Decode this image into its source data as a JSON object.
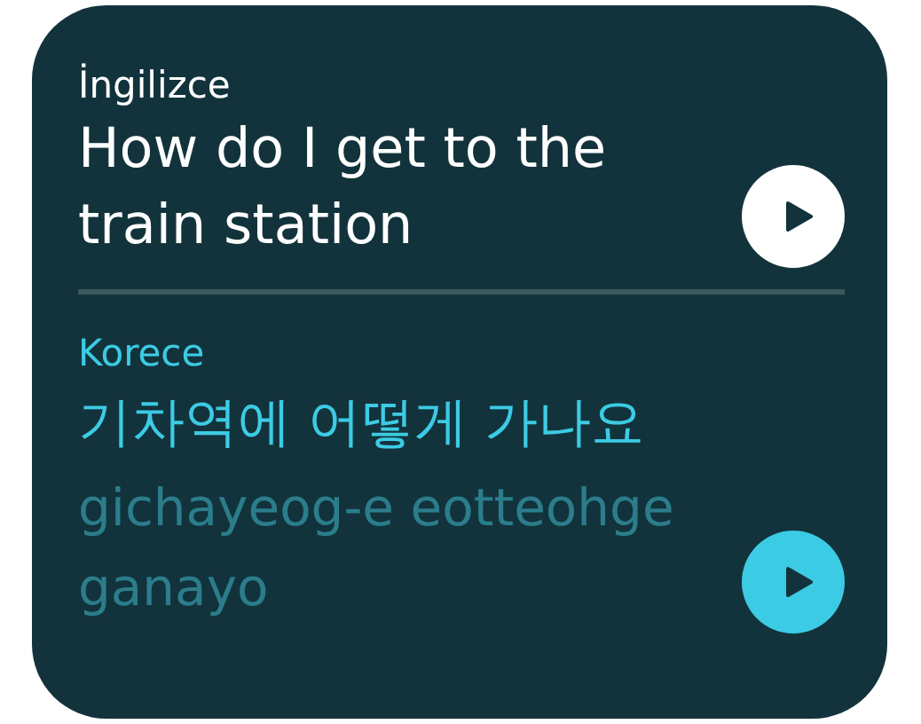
{
  "sections": [
    {
      "kind": "source",
      "language": "İngilizce",
      "text": "How do I get to the train station"
    },
    {
      "kind": "target",
      "language": "Korece",
      "text": "기차역에 어떻게 가나요",
      "romanization": "gichayeog-e eotteohge ganayo"
    }
  ]
}
